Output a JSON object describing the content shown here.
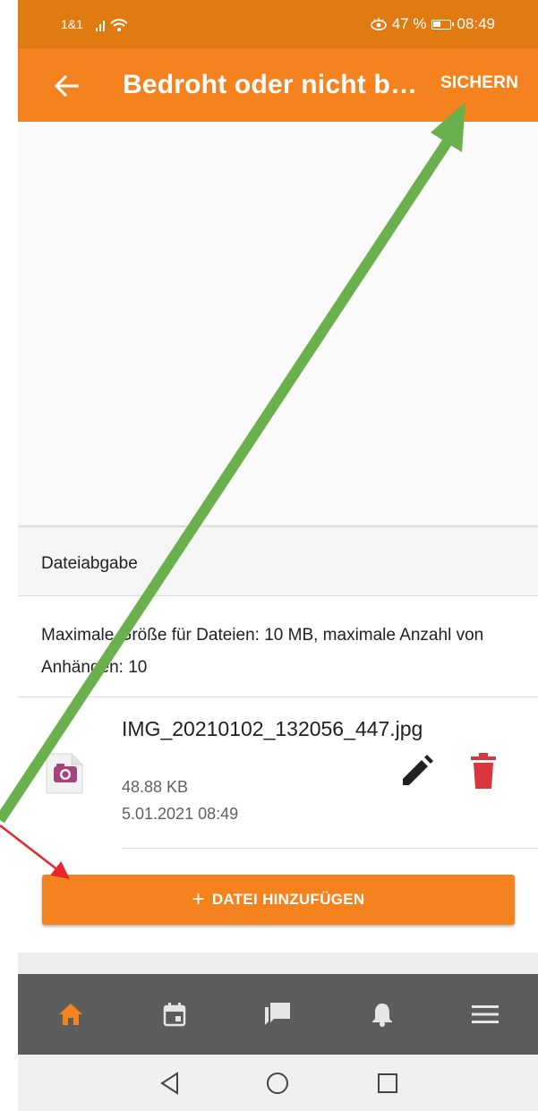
{
  "status_bar": {
    "carrier": "1&1",
    "battery": "47 %",
    "time": "08:49"
  },
  "app_bar": {
    "title": "Bedroht oder nicht b…",
    "save_label": "SICHERN"
  },
  "section": {
    "title": "Dateiabgabe",
    "info": "Maximale Größe für Dateien: 10 MB, maximale Anzahl von Anhängen: 10"
  },
  "file": {
    "name": "IMG_20210102_132056_447.jpg",
    "size": "48.88 KB",
    "date": "5.01.2021 08:49"
  },
  "add_button": {
    "plus": "+",
    "label": "DATEI HINZUFÜGEN"
  },
  "colors": {
    "accent": "#f4821e",
    "status_bar": "#e07b12",
    "delete": "#d9363e",
    "nav_active": "#f4821e",
    "nav_bg": "#5c5c5c",
    "arrow_green": "#6ab04c",
    "arrow_red": "#e8262c"
  },
  "icons": {
    "back": "arrow-left-icon",
    "edit": "pencil-icon",
    "delete": "trash-icon",
    "file": "image-file-icon",
    "nav": [
      "home-icon",
      "calendar-icon",
      "chat-icon",
      "bell-icon",
      "menu-icon"
    ],
    "system": [
      "back-triangle-icon",
      "home-circle-icon",
      "recents-square-icon"
    ]
  }
}
